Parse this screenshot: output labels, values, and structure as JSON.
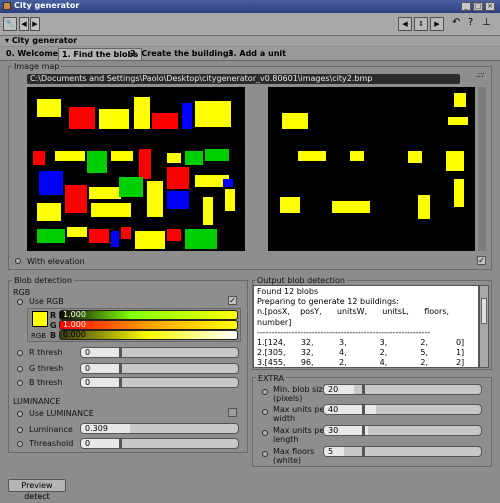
{
  "window": {
    "title": "City generator"
  },
  "toolbar": {
    "left_icons": [
      "wrench-icon",
      "back-icon",
      "forward-icon"
    ],
    "right_icons": [
      "arrow-left-icon",
      "arrow-up-down-icon",
      "arrow-right-icon",
      "undo-icon",
      "help-icon",
      "pin-icon"
    ]
  },
  "section": {
    "title": "City generator"
  },
  "tabs": [
    {
      "label": "0. Welcome",
      "active": false
    },
    {
      "label": "1. Find the blobs",
      "active": true
    },
    {
      "label": "2. Create the buildings",
      "active": false
    },
    {
      "label": "3. Add a unit",
      "active": false
    }
  ],
  "image_map": {
    "label": "Image map",
    "path": "C:\\Documents and Settings\\Paolo\\Desktop\\citygenerator_v0.80601\\images\\city2.bmp",
    "browse": "...",
    "with_elevation": "With elevation",
    "with_elevation_checked": true
  },
  "blob_detection": {
    "label": "Blob detection",
    "rgb_label": "RGB",
    "use_rgb": "Use RGB",
    "use_rgb_checked": true,
    "swatch_color": "#ffff00",
    "rgb_caption": "RGB",
    "r_label": "R",
    "r_value": "1.000",
    "g_label": "G",
    "g_value": "1.000",
    "b_label": "B",
    "b_value": "0.000",
    "r_thresh": "R thresh",
    "r_thresh_value": "0",
    "g_thresh": "G thresh",
    "g_thresh_value": "0",
    "b_thresh": "B thresh",
    "b_thresh_value": "0",
    "luminance_label": "LUMINANCE",
    "use_luminance": "Use LUMINANCE",
    "use_luminance_checked": false,
    "luminance": "Luminance",
    "luminance_value": "0.309",
    "luminance_level": 0.309,
    "threshold": "Threashold",
    "threshold_value": "0"
  },
  "output": {
    "label": "Output blob detection",
    "text": "Found 12 blobs\nPreparing to generate 12 buildings:\nn.[posX,    posY,      unitsW,      unitsL,      floors,\nnumber]\n------------------------------------------------------------\n1.[124,      32,          3,             3,             2,           0]\n2.[305,      32,          4,             2,             5,           1]\n3.[455,      96,          2,             4,             2,           2]"
  },
  "extra": {
    "label": "EXTRA",
    "items": [
      {
        "label": "Min. blob size\n(pixels)",
        "value": "20",
        "level": 0.2
      },
      {
        "label": "Max units per\nwidth",
        "value": "40",
        "level": 0.4
      },
      {
        "label": "Max units per\nlength",
        "value": "30",
        "level": 0.3
      },
      {
        "label": "Max floors\n(white)",
        "value": "5",
        "level": 0.05
      }
    ]
  },
  "preview_button": "Preview detect",
  "colors": {
    "yellow": "#ffff00",
    "red": "#ff0000",
    "green": "#00d000",
    "blue": "#0000ff",
    "black": "#000000"
  }
}
